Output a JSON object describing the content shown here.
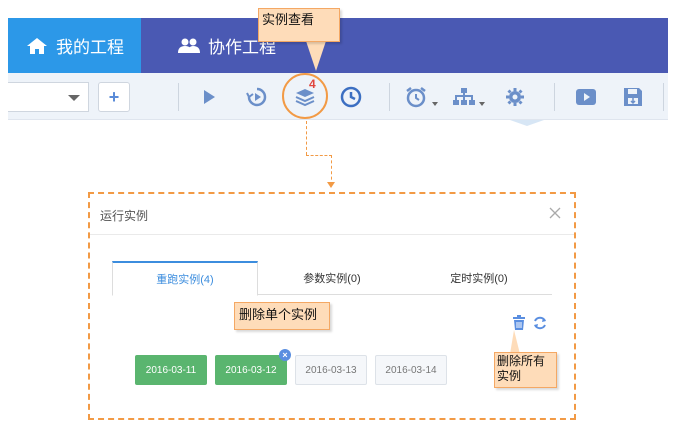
{
  "nav": {
    "tabs": [
      {
        "label": "我的工程",
        "icon": "home-icon",
        "active": true
      },
      {
        "label": "协作工程",
        "icon": "users-icon",
        "active": false
      }
    ],
    "active_color": "#2c98e8",
    "bar_color": "#4a59b3"
  },
  "toolbar": {
    "plus_label": "+",
    "instances_badge": "4",
    "icons": [
      "plus-icon",
      "play-icon",
      "replay-icon",
      "layers-icon",
      "clock-icon",
      "alarm-icon",
      "hierarchy-icon",
      "gear-icon",
      "video-icon",
      "save-icon"
    ]
  },
  "callouts": {
    "view_instances": "实例查看",
    "delete_single": "删除单个实例",
    "delete_all": "删除所有实例"
  },
  "dialog": {
    "title": "运行实例",
    "tabs": [
      {
        "label": "重跑实例(4)",
        "active": true
      },
      {
        "label": "参数实例(0)",
        "active": false
      },
      {
        "label": "定时实例(0)",
        "active": false
      }
    ],
    "instances": [
      {
        "date": "2016-03-11",
        "state": "success"
      },
      {
        "date": "2016-03-12",
        "state": "success"
      },
      {
        "date": "2016-03-13",
        "state": "idle"
      },
      {
        "date": "2016-03-14",
        "state": "idle"
      }
    ],
    "delete_badge": "×"
  },
  "colors": {
    "highlight": "#f29a45",
    "callout_bg": "#fedcb9",
    "success": "#5ab56f",
    "tab_active": "#3c8dde"
  }
}
